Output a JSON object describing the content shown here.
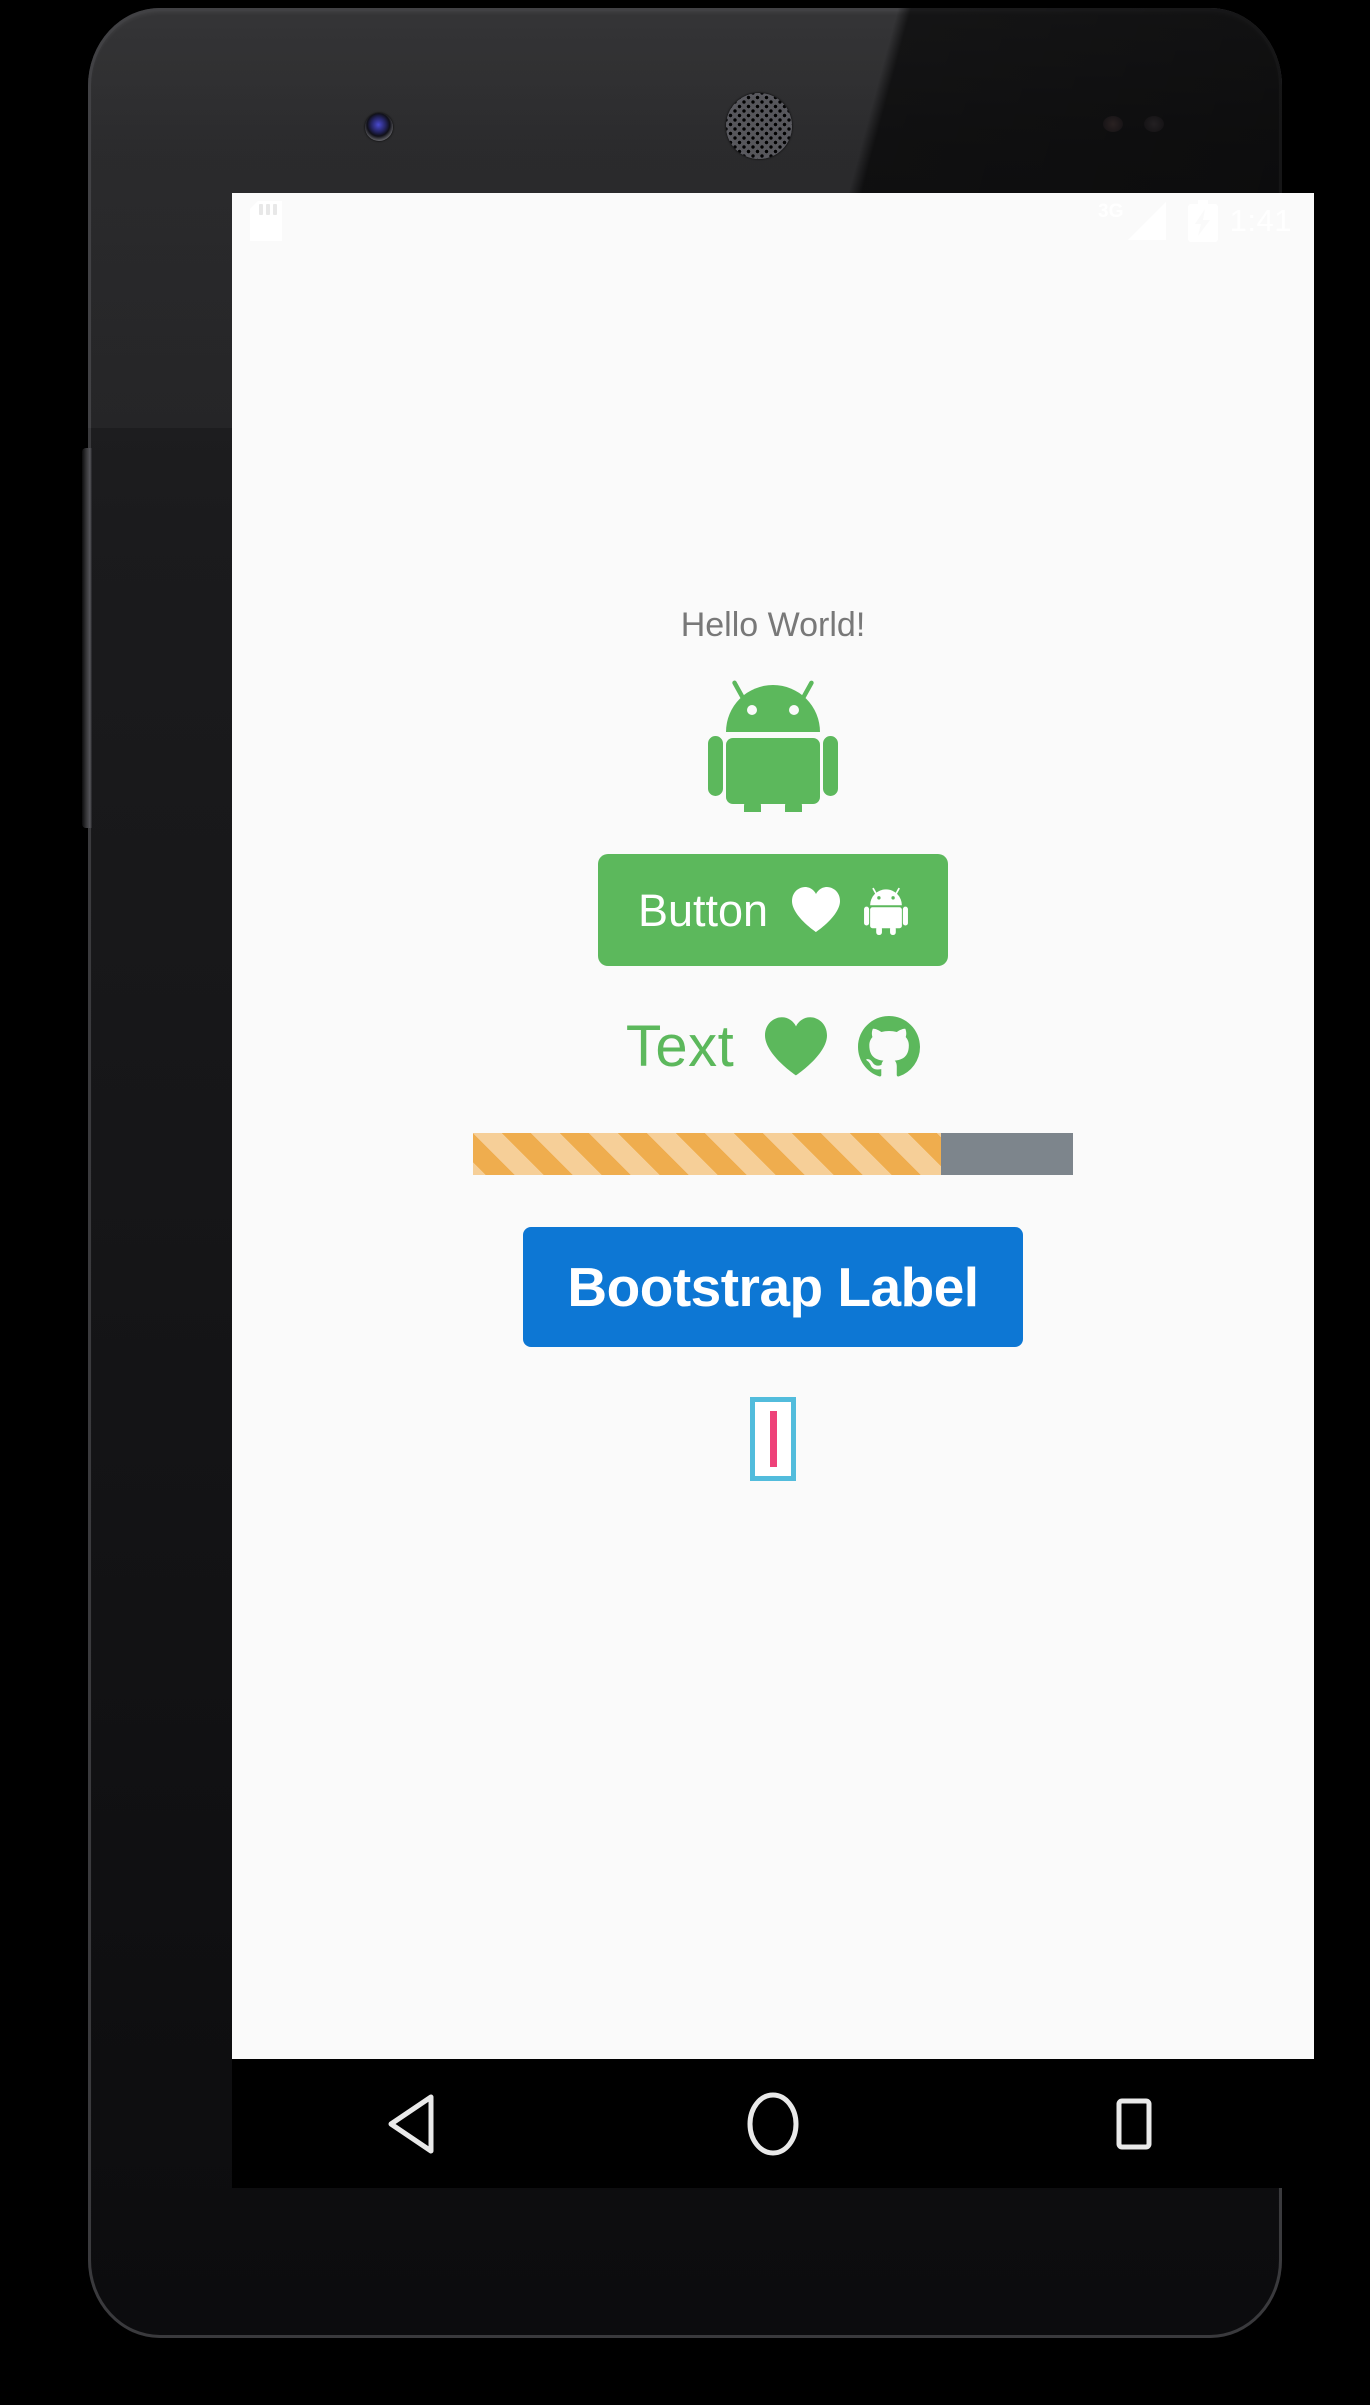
{
  "device": {
    "name": "android-phone-mockup",
    "hardware": {
      "front_camera": "front-camera-icon",
      "earpiece": "earpiece-speaker-icon",
      "proximity_sensor": "proximity-sensor-icon",
      "light_sensor": "light-sensor-icon",
      "volume_rocker": "volume-rocker-button",
      "power_button": "power-button"
    }
  },
  "status_bar": {
    "left_icons": [
      {
        "name": "sim-card-icon",
        "label": "SIM card"
      }
    ],
    "network_label": "3G",
    "signal_icon": "signal-bars-icon",
    "battery_icon": "battery-charging-icon",
    "clock": "1:41",
    "background": "#fafafa",
    "foreground": "#ffffff"
  },
  "app": {
    "background": "#fafafa",
    "hello_text": "Hello World!",
    "hello_text_color": "#787878",
    "android_logo": {
      "name": "android-robot-icon",
      "color": "#5cb85c"
    },
    "button": {
      "label": "Button",
      "background": "#5cb85c",
      "text_color": "#ffffff",
      "icons": [
        {
          "name": "heart-icon",
          "color": "#ffffff"
        },
        {
          "name": "android-icon",
          "color": "#ffffff"
        }
      ]
    },
    "text_row": {
      "label": "Text",
      "color": "#5cb85c",
      "icons": [
        {
          "name": "heart-icon",
          "color": "#5cb85c"
        },
        {
          "name": "github-icon",
          "color": "#5cb85c"
        }
      ]
    },
    "progress": {
      "name": "bootstrap-progress-bar",
      "percent": 78,
      "striped": true,
      "fill_color": "#efad4e",
      "track_color": "#7d858c"
    },
    "blue_label": {
      "label": "Bootstrap Label",
      "background": "#0d77d4",
      "text_color": "#ffffff"
    },
    "edit_text": {
      "name": "bootstrap-edit-text",
      "value": "",
      "placeholder": "",
      "border_color": "#52bcdc",
      "caret_color": "#ee4279"
    }
  },
  "nav_bar": {
    "background": "#000000",
    "buttons": [
      {
        "name": "nav-back-button",
        "icon": "back-triangle-icon"
      },
      {
        "name": "nav-home-button",
        "icon": "home-circle-icon"
      },
      {
        "name": "nav-recents-button",
        "icon": "recents-square-icon"
      }
    ]
  }
}
